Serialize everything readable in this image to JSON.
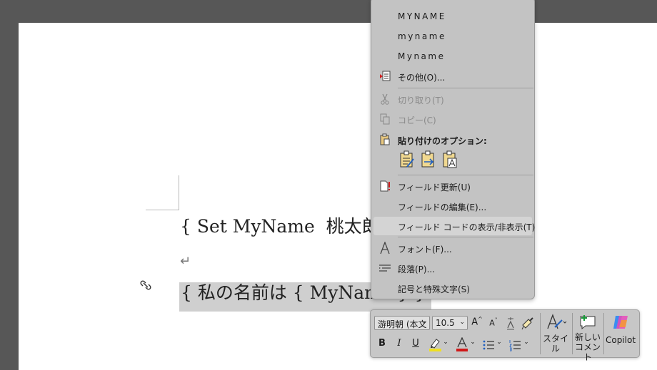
{
  "document": {
    "line1": "{ Set MyName  桃太郎",
    "line3": "{ 私の名前は { MyName } }",
    "paragraph_mark": "↵"
  },
  "context_menu": {
    "case_items": [
      "MYNAME",
      "myname",
      "Myname"
    ],
    "more": "その他(O)...",
    "cut": "切り取り(T)",
    "copy": "コピー(C)",
    "paste_options_label": "貼り付けのオプション:",
    "update_field": "フィールド更新(U)",
    "edit_field": "フィールドの編集(E)...",
    "toggle_field_codes": "フィールド コードの表示/非表示(T)",
    "font": "フォント(F)...",
    "paragraph": "段落(P)...",
    "symbols": "記号と特殊文字(S)"
  },
  "mini_toolbar": {
    "font_name": "游明朝 (本文",
    "font_size": "10.5",
    "grow_font": "A",
    "shrink_font": "A",
    "bold": "B",
    "italic": "I",
    "underline": "U",
    "style_label": "スタイル",
    "new_comment_line1": "新しい",
    "new_comment_line2": "コメント",
    "copilot_label": "Copilot",
    "highlight_color": "#f0e020",
    "font_color": "#d01818"
  }
}
